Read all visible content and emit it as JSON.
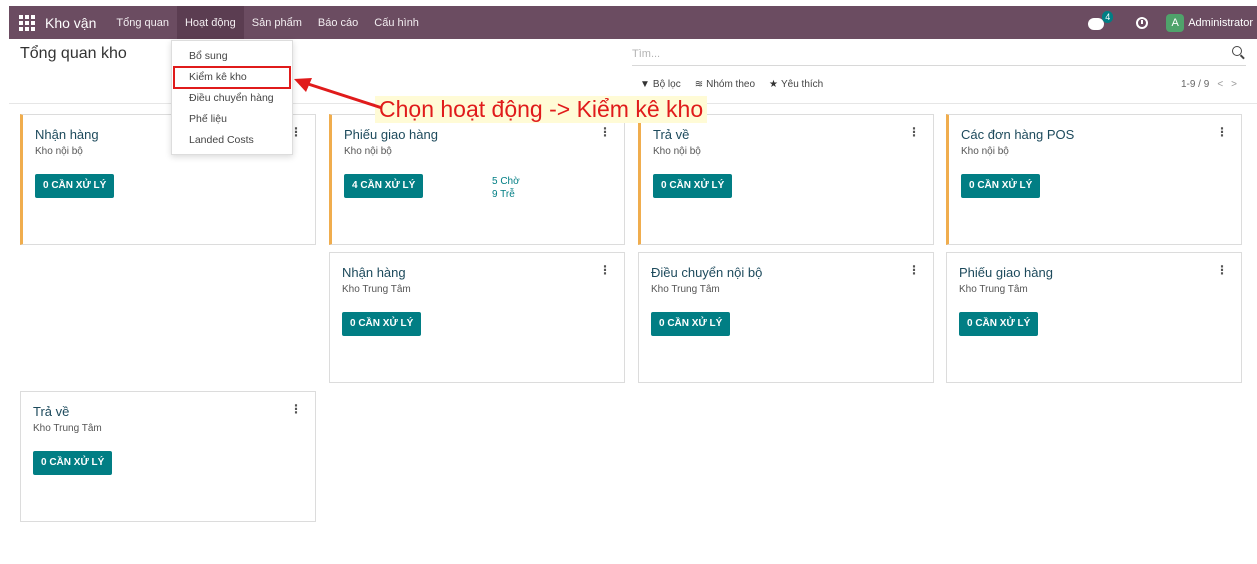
{
  "navbar": {
    "app_name": "Kho vận",
    "menus": [
      "Tổng quan",
      "Hoạt động",
      "Sản phẩm",
      "Báo cáo",
      "Cấu hình"
    ],
    "chat_count": "4",
    "avatar_letter": "A",
    "user_name": "Administrator"
  },
  "page": {
    "title": "Tổng quan kho"
  },
  "search": {
    "placeholder": "Tìm..."
  },
  "filters": {
    "filter_label": "Bộ lọc",
    "group_label": "Nhóm theo",
    "favorite_label": "Yêu thích"
  },
  "pager": {
    "text": "1-9 / 9"
  },
  "dropdown": {
    "items": [
      "Bổ sung",
      "Kiểm kê kho",
      "Điều chuyển hàng",
      "Phế liệu",
      "Landed Costs"
    ]
  },
  "annotation": {
    "text": "Chọn hoạt động -> Kiểm kê kho"
  },
  "cards": [
    {
      "title": "Nhận hàng",
      "subtitle": "Kho nội bộ",
      "button": "0 CẦN XỬ LÝ"
    },
    {
      "title": "Phiếu giao hàng",
      "subtitle": "Kho nội bộ",
      "button": "4 CẦN XỬ LÝ",
      "stat1": "5 Chờ",
      "stat2": "9 Trễ"
    },
    {
      "title": "Trả về",
      "subtitle": "Kho nội bộ",
      "button": "0 CẦN XỬ LÝ"
    },
    {
      "title": "Các đơn hàng POS",
      "subtitle": "Kho nội bộ",
      "button": "0 CẦN XỬ LÝ"
    },
    {
      "title": "Nhận hàng",
      "subtitle": "Kho Trung Tâm",
      "button": "0 CẦN XỬ LÝ"
    },
    {
      "title": "Điều chuyển nội bộ",
      "subtitle": "Kho Trung Tâm",
      "button": "0 CẦN XỬ LÝ"
    },
    {
      "title": "Phiếu giao hàng",
      "subtitle": "Kho Trung Tâm",
      "button": "0 CẦN XỬ LÝ"
    },
    {
      "title": "Trả về",
      "subtitle": "Kho Trung Tâm",
      "button": "0 CẦN XỬ LÝ"
    }
  ],
  "colors": {
    "navbar": "#6b4c61",
    "primary": "#017e84",
    "accent": "#f0ad4e",
    "annotation": "#e01b1b"
  }
}
